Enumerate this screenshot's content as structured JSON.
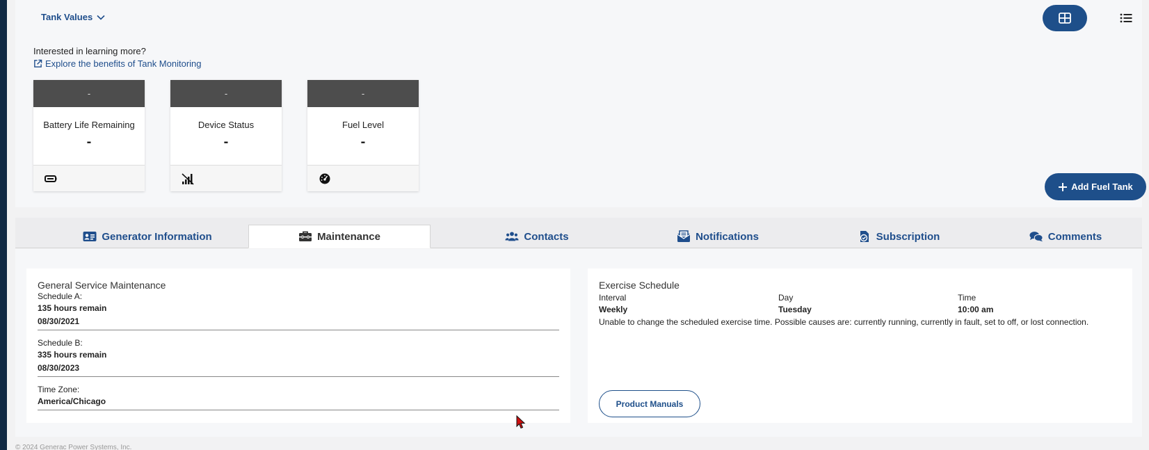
{
  "tank_panel": {
    "toggle_label": "Tank Values",
    "learn_text": "Interested in learning more?",
    "learn_link": "Explore the benefits of Tank Monitoring",
    "cards": [
      {
        "head": "-",
        "label": "Battery Life Remaining",
        "value": "-",
        "icon": "battery-icon"
      },
      {
        "head": "-",
        "label": "Device Status",
        "value": "-",
        "icon": "signal-icon"
      },
      {
        "head": "-",
        "label": "Fuel Level",
        "value": "-",
        "icon": "gauge-icon"
      }
    ],
    "add_button": "Add Fuel Tank"
  },
  "tabs": [
    {
      "label": "Generator Information",
      "icon": "id-card-icon"
    },
    {
      "label": "Maintenance",
      "icon": "toolbox-icon",
      "active": true
    },
    {
      "label": "Contacts",
      "icon": "users-icon"
    },
    {
      "label": "Notifications",
      "icon": "envelope-icon"
    },
    {
      "label": "Subscription",
      "icon": "subscription-icon"
    },
    {
      "label": "Comments",
      "icon": "comments-icon"
    }
  ],
  "maintenance": {
    "title": "General Service Maintenance",
    "schedule_a_label": "Schedule A:",
    "schedule_a_hours": "135 hours remain",
    "schedule_a_date": "08/30/2021",
    "schedule_b_label": "Schedule B:",
    "schedule_b_hours": "335 hours remain",
    "schedule_b_date": "08/30/2023",
    "timezone_label": "Time Zone:",
    "timezone_value": "America/Chicago"
  },
  "exercise": {
    "title": "Exercise Schedule",
    "interval_label": "Interval",
    "interval_value": "Weekly",
    "day_label": "Day",
    "day_value": "Tuesday",
    "time_label": "Time",
    "time_value": "10:00 am",
    "note": "Unable to change the scheduled exercise time. Possible causes are: currently running, currently in fault, set to off, or lost connection.",
    "manuals_button": "Product Manuals"
  },
  "footer": {
    "copyright": "© 2024 Generac Power Systems, Inc."
  },
  "colors": {
    "accent": "#1e4f8a",
    "card_head": "#4d4d4d",
    "sidebar": "#112a44"
  }
}
